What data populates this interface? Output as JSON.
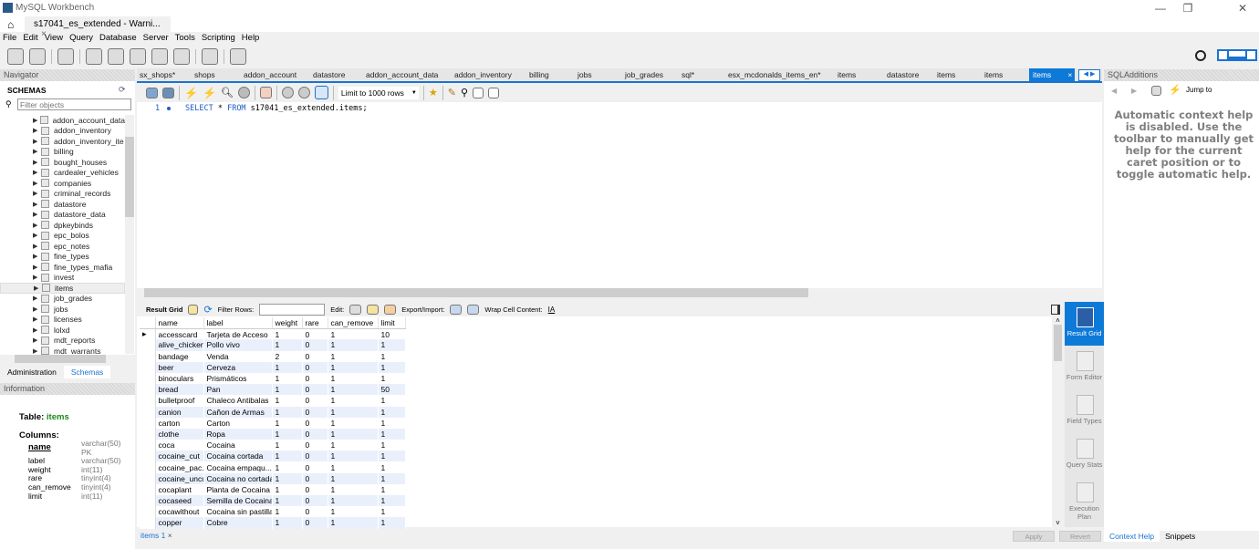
{
  "app": {
    "title": "MySQL Workbench",
    "doc_tab": "s17041_es_extended - Warni...",
    "close": "×"
  },
  "menu": [
    "File",
    "Edit",
    "View",
    "Query",
    "Database",
    "Server",
    "Tools",
    "Scripting",
    "Help"
  ],
  "navigator": {
    "header": "Navigator",
    "schemas_label": "SCHEMAS",
    "filter_placeholder": "Filter objects",
    "tables": [
      "addon_account_data",
      "addon_inventory",
      "addon_inventory_ite",
      "billing",
      "bought_houses",
      "cardealer_vehicles",
      "companies",
      "criminal_records",
      "datastore",
      "datastore_data",
      "dpkeybinds",
      "epc_bolos",
      "epc_notes",
      "fine_types",
      "fine_types_mafia",
      "invest",
      "items",
      "job_grades",
      "jobs",
      "licenses",
      "lolxd",
      "mdt_reports",
      "mdt_warrants"
    ],
    "selected": "items",
    "tabs": [
      "Administration",
      "Schemas"
    ]
  },
  "information": {
    "header": "Information",
    "table_label": "Table:",
    "table_name": "items",
    "columns_label": "Columns:",
    "columns": [
      {
        "name": "name",
        "type": "varchar(50)",
        "extra": "PK"
      },
      {
        "name": "label",
        "type": "varchar(50)"
      },
      {
        "name": "weight",
        "type": "int(11)"
      },
      {
        "name": "rare",
        "type": "tinyint(4)"
      },
      {
        "name": "can_remove",
        "type": "tinyint(4)"
      },
      {
        "name": "limit",
        "type": "int(11)"
      }
    ]
  },
  "query_tabs": [
    "sx_shops*",
    "shops",
    "addon_account",
    "datastore",
    "addon_account_data",
    "addon_inventory",
    "billing",
    "jobs",
    "job_grades",
    "sql*",
    "esx_mcdonalds_items_en*",
    "items",
    "datastore",
    "items",
    "items",
    "items"
  ],
  "editor": {
    "limit": "Limit to 1000 rows",
    "line": "1",
    "sql_kw1": "SELECT",
    "sql_mid": " * ",
    "sql_kw2": "FROM",
    "sql_rest": " s17041_es_extended.items;"
  },
  "result_toolbar": {
    "result_grid": "Result Grid",
    "filter_rows": "Filter Rows:",
    "edit": "Edit:",
    "export": "Export/Import:",
    "wrap": "Wrap Cell Content:"
  },
  "grid": {
    "columns": [
      "name",
      "label",
      "weight",
      "rare",
      "can_remove",
      "limit"
    ],
    "rows": [
      [
        "accesscard",
        "Tarjeta de Acceso",
        "1",
        "0",
        "1",
        "10"
      ],
      [
        "alive_chicken",
        "Pollo vivo",
        "1",
        "0",
        "1",
        "1"
      ],
      [
        "bandage",
        "Venda",
        "2",
        "0",
        "1",
        "1"
      ],
      [
        "beer",
        "Cerveza",
        "1",
        "0",
        "1",
        "1"
      ],
      [
        "binoculars",
        "Prismáticos",
        "1",
        "0",
        "1",
        "1"
      ],
      [
        "bread",
        "Pan",
        "1",
        "0",
        "1",
        "50"
      ],
      [
        "bulletproof",
        "Chaleco Antibalas",
        "1",
        "0",
        "1",
        "1"
      ],
      [
        "canion",
        "Cañon de Armas",
        "1",
        "0",
        "1",
        "1"
      ],
      [
        "carton",
        "Carton",
        "1",
        "0",
        "1",
        "1"
      ],
      [
        "clothe",
        "Ropa",
        "1",
        "0",
        "1",
        "1"
      ],
      [
        "coca",
        "Cocaina",
        "1",
        "0",
        "1",
        "1"
      ],
      [
        "cocaine_cut",
        "Cocaina cortada",
        "1",
        "0",
        "1",
        "1"
      ],
      [
        "cocaine_pac...",
        "Cocaina empaqu...",
        "1",
        "0",
        "1",
        "1"
      ],
      [
        "cocaine_uncut",
        "Cocaina no cortada",
        "1",
        "0",
        "1",
        "1"
      ],
      [
        "cocaplant",
        "Planta de Cocaina",
        "1",
        "0",
        "1",
        "1"
      ],
      [
        "cocaseed",
        "Semilla de Cocaina",
        "1",
        "0",
        "1",
        "1"
      ],
      [
        "cocawithout",
        "Cocaina sin pastillas",
        "1",
        "0",
        "1",
        "1"
      ],
      [
        "copper",
        "Cobre",
        "1",
        "0",
        "1",
        "1"
      ]
    ]
  },
  "side_panel": [
    "Result Grid",
    "Form Editor",
    "Field Types",
    "Query Stats",
    "Execution Plan"
  ],
  "bottom": {
    "result_tab": "items 1",
    "apply": "Apply",
    "revert": "Revert"
  },
  "sql_additions": {
    "header": "SQLAdditions",
    "jump_to": "Jump to",
    "help": "Automatic context help is disabled. Use the toolbar to manually get help for the current caret position or to toggle automatic help.",
    "tabs": [
      "Context Help",
      "Snippets"
    ]
  },
  "colors": {
    "accent": "#0e7ad8"
  }
}
